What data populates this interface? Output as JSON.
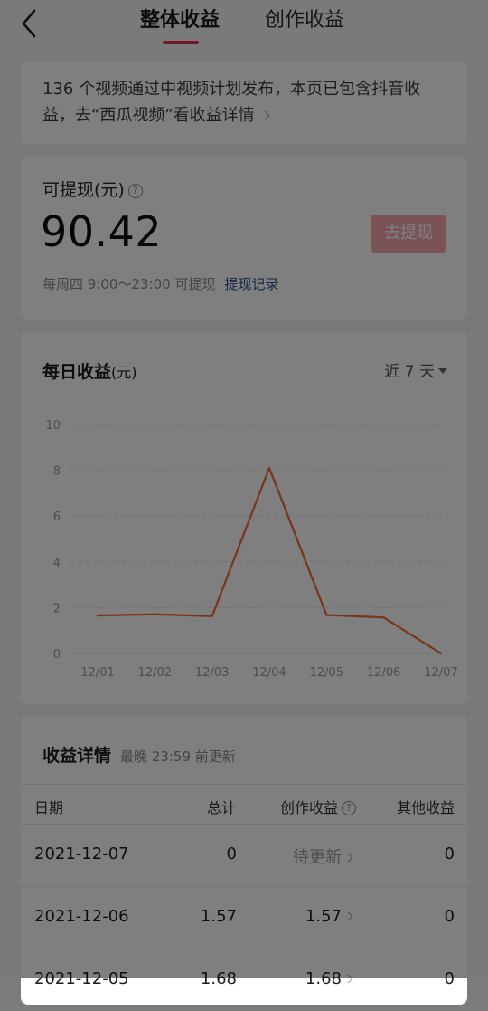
{
  "header": {
    "tabs": [
      {
        "label": "整体收益",
        "active": true
      },
      {
        "label": "创作收益",
        "active": false
      }
    ],
    "accent_color": "#e0324a"
  },
  "notice": {
    "text": "136 个视频通过中视频计划发布，本页已包含抖音收益，去“西瓜视频”看收益详情"
  },
  "balance": {
    "title": "可提现(元)",
    "value": "90.42",
    "withdraw_button": "去提现",
    "schedule": "每周四 9:00～23:00 可提现",
    "record_link": "提现记录"
  },
  "daily": {
    "title": "每日收益",
    "unit": "(元)",
    "range_selector": "近 7 天"
  },
  "chart_data": {
    "type": "line",
    "x": [
      "12/01",
      "12/02",
      "12/03",
      "12/04",
      "12/05",
      "12/06",
      "12/07"
    ],
    "series": [
      {
        "values": [
          1.66,
          1.71,
          1.63,
          8.1,
          1.68,
          1.57,
          0
        ]
      }
    ],
    "ylim": [
      0,
      10
    ],
    "yticks": [
      0,
      2,
      4,
      6,
      8,
      10
    ],
    "grid": true,
    "line_color": "#f06a36"
  },
  "details": {
    "title": "收益详情",
    "subtitle": "最晚 23:59 前更新",
    "columns": [
      "日期",
      "总计",
      "创作收益",
      "其他收益"
    ],
    "rows": [
      {
        "date": "2021-12-07",
        "total": "0",
        "creative": "待更新",
        "other": "0"
      },
      {
        "date": "2021-12-06",
        "total": "1.57",
        "creative": "1.57",
        "other": "0"
      },
      {
        "date": "2021-12-05",
        "total": "1.68",
        "creative": "1.68",
        "other": "0"
      }
    ]
  }
}
